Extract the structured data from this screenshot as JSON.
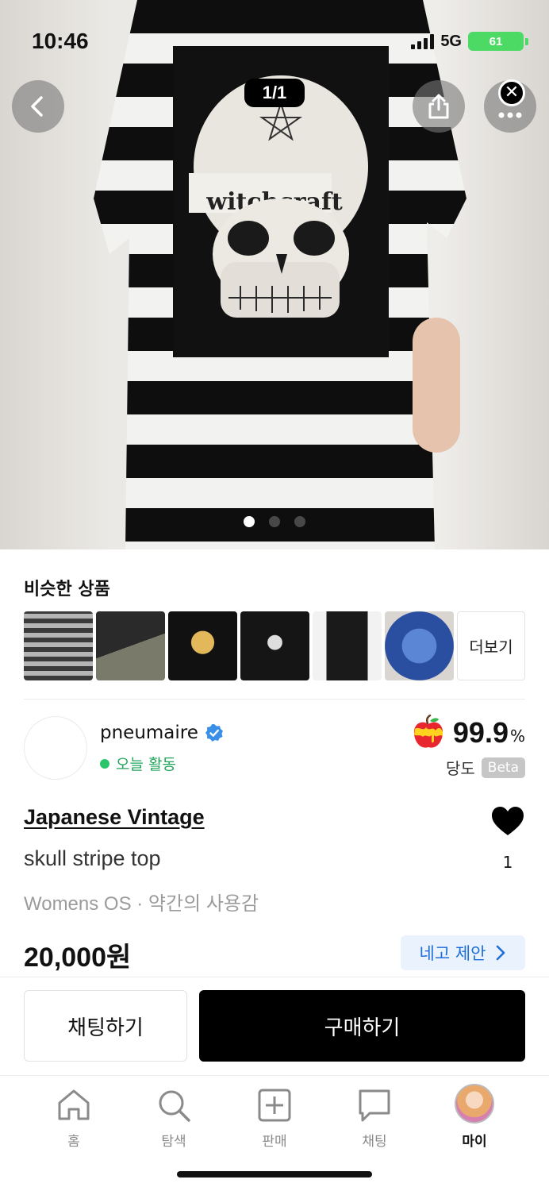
{
  "status_bar": {
    "time": "10:46",
    "network": "5G",
    "battery": "61"
  },
  "hero": {
    "image_counter": "1/1",
    "print_text": "witchcraft",
    "page_dots": 3,
    "active_dot": 0
  },
  "similar": {
    "title": "비슷한 상품",
    "more_label": "더보기"
  },
  "seller": {
    "name": "pneumaire",
    "activity": "오늘 활동",
    "score": "99.9",
    "score_unit": "%",
    "sweetness_label": "당도",
    "beta_label": "Beta"
  },
  "product": {
    "brand": "Japanese Vintage",
    "title": "skull stripe top",
    "meta": "Womens OS · 약간의 사용감",
    "price": "20,000원",
    "like_count": "1",
    "offer_label": "네고 제안"
  },
  "actions": {
    "chat_label": "채팅하기",
    "buy_label": "구매하기"
  },
  "tabbar": {
    "items": [
      {
        "label": "홈",
        "icon": "home-icon"
      },
      {
        "label": "탐색",
        "icon": "search-icon"
      },
      {
        "label": "판매",
        "icon": "plus-square-icon"
      },
      {
        "label": "채팅",
        "icon": "chat-bubble-icon"
      },
      {
        "label": "마이",
        "icon": "avatar"
      }
    ],
    "active_index": 4
  },
  "colors": {
    "accent_blue": "#1e6fd9",
    "active_green": "#21a55b",
    "battery_green": "#4cd964",
    "buy_button": "#000000"
  }
}
